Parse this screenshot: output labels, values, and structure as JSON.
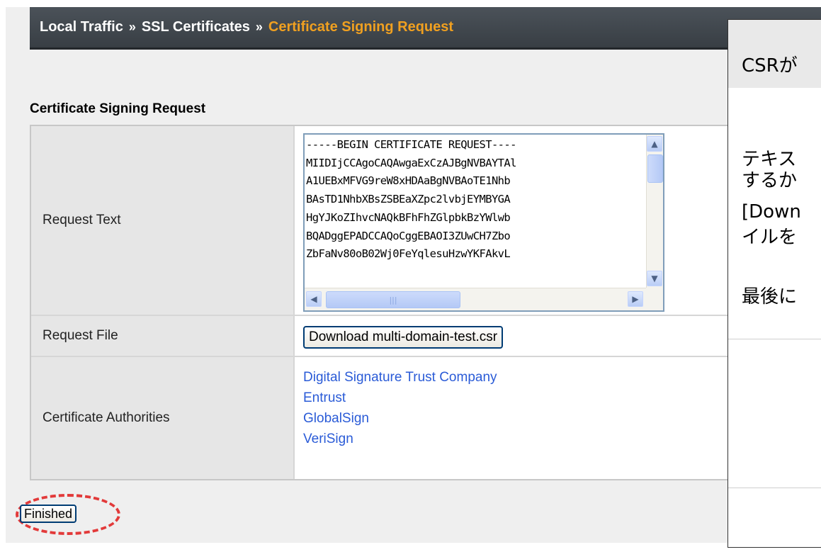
{
  "breadcrumb": {
    "part1": "Local Traffic",
    "sep1": "»",
    "part2": "SSL Certificates",
    "sep2": "»",
    "current": "Certificate Signing Request"
  },
  "section_title": "Certificate Signing Request",
  "rows": {
    "request_text": {
      "label": "Request Text",
      "lines": [
        "-----BEGIN CERTIFICATE REQUEST----",
        "MIIDIjCCAgoCAQAwgaExCzAJBgNVBAYTAl",
        "A1UEBxMFVG9reW8xHDAaBgNVBAoTE1Nhb",
        "BAsTD1NhbXBsZSBEaXZpc2lvbjEYMBYGA",
        "HgYJKoZIhvcNAQkBFhFhZGlpbkBzYWlwb",
        "BQADggEPADCCAQoCggEBAOI3ZUwCH7Zbo",
        "ZbFaNv80oB02Wj0FeYqlesuHzwYKFAkvL"
      ]
    },
    "request_file": {
      "label": "Request File",
      "button": "Download multi-domain-test.csr"
    },
    "certificate_authorities": {
      "label": "Certificate Authorities",
      "links": [
        "Digital Signature Trust Company",
        "Entrust",
        "GlobalSign",
        "VeriSign"
      ]
    }
  },
  "finished_button": "Finished",
  "annotation": {
    "line1": "CSRが",
    "line2": "テキス",
    "line3": "するか",
    "line4": "[Down",
    "line5": "イルを",
    "line6": "最後に"
  },
  "colors": {
    "breadcrumb_current": "#f0a020",
    "link": "#2a5bd7",
    "highlight": "#e23a3a"
  }
}
